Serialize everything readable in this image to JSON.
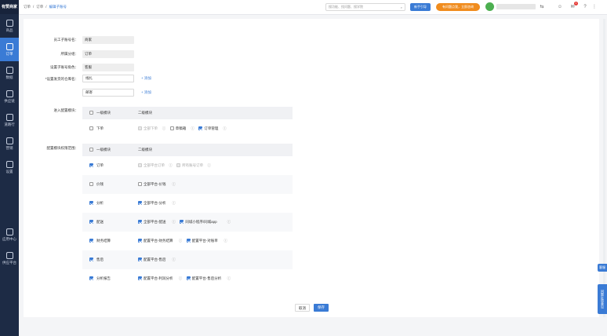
{
  "sidebar": {
    "logo": "有赞商家",
    "items": [
      {
        "label": "商品",
        "active": false,
        "icon": "bag-icon"
      },
      {
        "label": "订单",
        "active": true,
        "icon": "order-icon"
      },
      {
        "label": "数据",
        "active": false,
        "icon": "chart-icon"
      },
      {
        "label": "供应链",
        "active": false,
        "icon": "link-icon"
      },
      {
        "label": "道路行",
        "active": false,
        "icon": "store-icon"
      },
      {
        "label": "营销",
        "active": false,
        "icon": "tag-icon"
      },
      {
        "label": "设置",
        "active": false,
        "icon": "gear-icon"
      },
      {
        "label": "应用中心",
        "active": false,
        "icon": "apps-icon"
      },
      {
        "label": "供应平台",
        "active": false,
        "icon": "box-icon"
      }
    ]
  },
  "header": {
    "breadcrumb": [
      "订单",
      "订单",
      "编辑子账号"
    ],
    "search_placeholder": "搜功能、找问题、搜学院",
    "btn_blue": "新手引导",
    "btn_orange": "有问题点我，立即咨询",
    "badge": "1"
  },
  "form": {
    "labels": {
      "name": "员工子账号名：",
      "group": "所属分组：",
      "role": "设置子账号角色：",
      "delivery": "*设置发货的仓库名：",
      "enter_module": "进入配置模块：",
      "config_perm": "配置模块权限范围："
    },
    "values": {
      "name": "商家",
      "group": "订单",
      "role": "客服",
      "delivery1": "线扎",
      "delivery2": "邮寄"
    },
    "add_label": "+ 添加"
  },
  "table1": {
    "headers": [
      "一级模块",
      "二级模块"
    ],
    "rows": [
      {
        "level1": "下单",
        "checked": false,
        "subs": [
          {
            "label": "全部下单",
            "state": "disabled"
          },
          {
            "label": "草稿箱",
            "state": "off"
          },
          {
            "label": "订单管理",
            "state": "on"
          }
        ]
      }
    ]
  },
  "table2": {
    "headers": [
      "一级模块",
      "二级模块"
    ],
    "rows": [
      {
        "level1": "订单",
        "checked": true,
        "subs": [
          {
            "label": "全部平台订单",
            "state": "disabled"
          },
          {
            "label": "所有账号订单",
            "state": "disabled"
          }
        ]
      },
      {
        "level1": "价钱",
        "checked": false,
        "subs": [
          {
            "label": "全部平台-价钱",
            "state": "off"
          }
        ]
      },
      {
        "level1": "分析",
        "checked": true,
        "subs": [
          {
            "label": "全部平台-分析",
            "state": "on"
          }
        ]
      },
      {
        "level1": "配送",
        "checked": true,
        "subs": [
          {
            "label": "全部平台-配送",
            "state": "on"
          },
          {
            "label": "同城小程序/同城app",
            "state": "on"
          }
        ]
      },
      {
        "level1": "财务结算",
        "checked": true,
        "subs": [
          {
            "label": "配置平台-财务结算",
            "state": "on"
          },
          {
            "label": "配置平台-对账单",
            "state": "on"
          }
        ]
      },
      {
        "level1": "售后",
        "checked": true,
        "subs": [
          {
            "label": "配置平台-售后",
            "state": "on"
          }
        ]
      },
      {
        "level1": "分析报告",
        "checked": true,
        "subs": [
          {
            "label": "配置平台-利润分析",
            "state": "on"
          },
          {
            "label": "配置平台-售后分析",
            "state": "on"
          }
        ]
      }
    ]
  },
  "footer": {
    "cancel": "取消",
    "save": "保存"
  },
  "side_tabs": {
    "service": "客服",
    "feedback": "问题反馈意见"
  }
}
